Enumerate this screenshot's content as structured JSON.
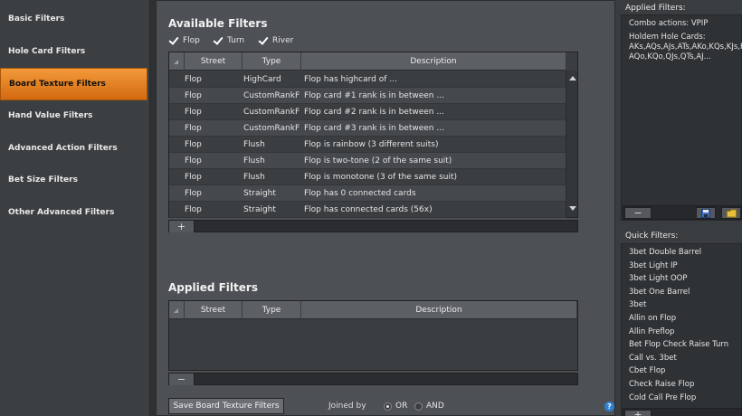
{
  "sidebar": {
    "items": [
      {
        "label": "Basic Filters"
      },
      {
        "label": "Hole Card Filters"
      },
      {
        "label": "Board Texture Filters"
      },
      {
        "label": "Hand Value Filters"
      },
      {
        "label": "Advanced Action Filters"
      },
      {
        "label": "Bet Size Filters"
      },
      {
        "label": "Other Advanced Filters"
      }
    ],
    "active_index": 2
  },
  "available": {
    "title": "Available Filters",
    "checkboxes": [
      {
        "label": "Flop",
        "checked": true
      },
      {
        "label": "Turn",
        "checked": true
      },
      {
        "label": "River",
        "checked": true
      }
    ],
    "columns": [
      "Street",
      "Type",
      "Description"
    ],
    "rows": [
      {
        "street": "Flop",
        "type": "HighCard",
        "description": "Flop has highcard of ..."
      },
      {
        "street": "Flop",
        "type": "CustomRankF",
        "description": "Flop card #1 rank is in between ..."
      },
      {
        "street": "Flop",
        "type": "CustomRankF",
        "description": "Flop card #2 rank is in between ..."
      },
      {
        "street": "Flop",
        "type": "CustomRankF",
        "description": "Flop card #3 rank is in between ..."
      },
      {
        "street": "Flop",
        "type": "Flush",
        "description": "Flop is rainbow (3 different suits)"
      },
      {
        "street": "Flop",
        "type": "Flush",
        "description": "Flop is two-tone (2 of the same suit)"
      },
      {
        "street": "Flop",
        "type": "Flush",
        "description": "Flop is monotone (3 of the same suit)"
      },
      {
        "street": "Flop",
        "type": "Straight",
        "description": "Flop has 0 connected cards"
      },
      {
        "street": "Flop",
        "type": "Straight",
        "description": "Flop has connected cards (56x)"
      }
    ],
    "add_label": "+"
  },
  "applied": {
    "title": "Applied Filters",
    "columns": [
      "Street",
      "Type",
      "Description"
    ],
    "remove_label": "−"
  },
  "footer": {
    "save_label": "Save Board Texture Filters",
    "joined_label": "Joined by",
    "or_label": "OR",
    "and_label": "AND",
    "selected": "OR",
    "help_label": "?"
  },
  "right_panel": {
    "applied_label": "Applied Filters:",
    "applied_lines": [
      "Combo actions: VPIP",
      "Holdem Hole Cards:",
      "AKs,AQs,AJs,ATs,AKo,KQs,KJs,K",
      "AQo,KQo,QJs,QTs,AJ..."
    ],
    "remove_label": "−",
    "quick_label": "Quick Filters:",
    "quick_items": [
      "3bet Double Barrel",
      "3bet Light IP",
      "3bet Light OOP",
      "3bet One Barrel",
      "3bet",
      "Allin on Flop",
      "Allin Preflop",
      "Bet Flop Check Raise Turn",
      "Call vs. 3bet",
      "Cbet Flop",
      "Check Raise Flop",
      "Cold Call Pre Flop"
    ],
    "add_label": "+"
  },
  "colors": {
    "accent": "#e8821f",
    "help": "#2f7fd1"
  }
}
